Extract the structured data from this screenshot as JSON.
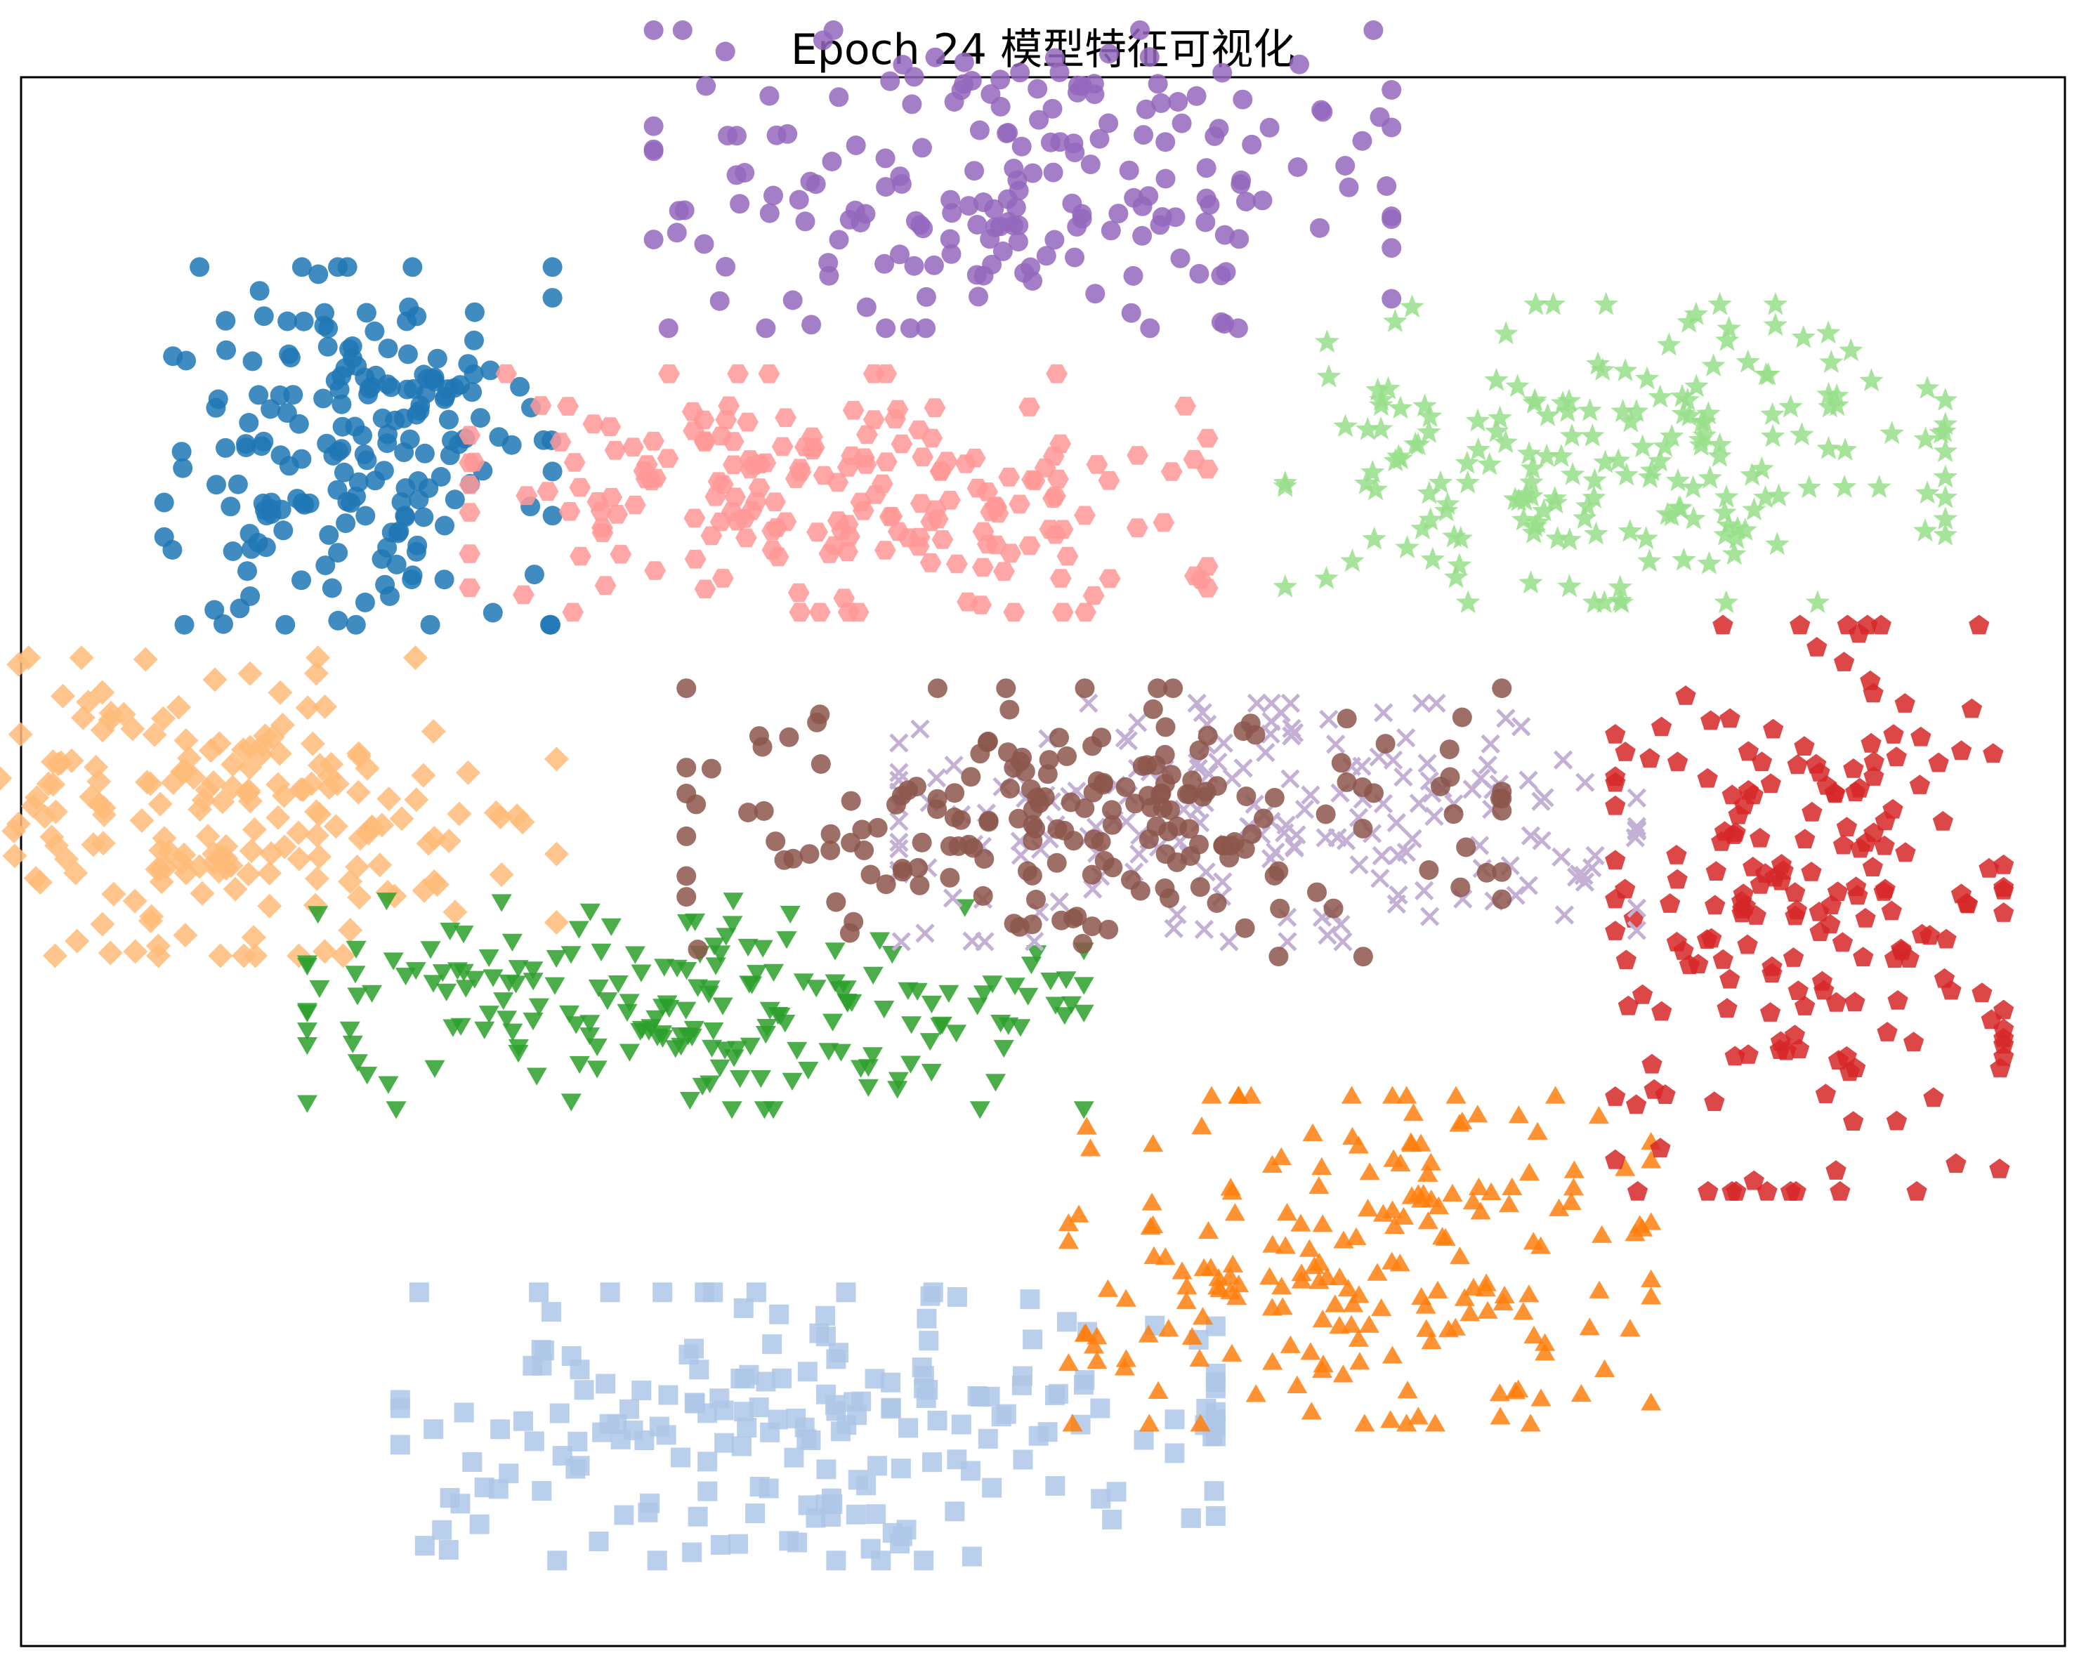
{
  "chart_data": {
    "type": "scatter",
    "title": "Epoch 24 模型特征可视化",
    "xlabel": "",
    "ylabel": "",
    "axes_ticks": "none",
    "legend": "none",
    "grid": false,
    "xlim": [
      -100,
      100
    ],
    "ylim": [
      -100,
      100
    ],
    "series": [
      {
        "class_index": 0,
        "marker": "circle",
        "color": "#1f77b4",
        "center": [
          -67,
          53
        ],
        "spread": [
          10,
          12
        ]
      },
      {
        "class_index": 1,
        "marker": "square",
        "color": "#aec7e8",
        "center": [
          -23,
          -72
        ],
        "spread": [
          21,
          9
        ]
      },
      {
        "class_index": 2,
        "marker": "triangle-up",
        "color": "#ff7f0e",
        "center": [
          31,
          -51
        ],
        "spread": [
          15,
          11
        ]
      },
      {
        "class_index": 3,
        "marker": "diamond",
        "color": "#ffbb78",
        "center": [
          -78,
          7
        ],
        "spread": [
          16,
          10
        ]
      },
      {
        "class_index": 4,
        "marker": "triangle-down",
        "color": "#2ca02c",
        "center": [
          -34,
          -18
        ],
        "spread": [
          20,
          7
        ]
      },
      {
        "class_index": 5,
        "marker": "star",
        "color": "#98df8a",
        "center": [
          56,
          52
        ],
        "spread": [
          17,
          10
        ]
      },
      {
        "class_index": 6,
        "marker": "pentagon",
        "color": "#d62728",
        "center": [
          75,
          -6
        ],
        "spread": [
          10,
          19
        ]
      },
      {
        "class_index": 7,
        "marker": "hexagon",
        "color": "#ff9896",
        "center": [
          -20,
          47
        ],
        "spread": [
          19,
          8
        ]
      },
      {
        "class_index": 8,
        "marker": "circle",
        "color": "#9467bd",
        "center": [
          -2,
          87
        ],
        "spread": [
          19,
          10
        ]
      },
      {
        "class_index": 9,
        "marker": "x",
        "color": "#c5b0d5",
        "center": [
          22,
          5
        ],
        "spread": [
          19,
          8
        ]
      },
      {
        "class_index": 10,
        "marker": "circle",
        "color": "#8c564b",
        "center": [
          5,
          5
        ],
        "spread": [
          21,
          9
        ]
      }
    ]
  }
}
